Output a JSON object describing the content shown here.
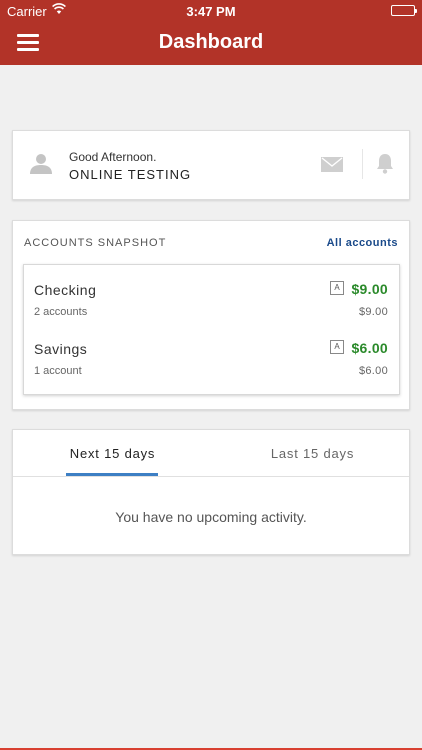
{
  "status": {
    "carrier": "Carrier",
    "time": "3:47 PM"
  },
  "nav": {
    "title": "Dashboard"
  },
  "greeting": {
    "hello": "Good Afternoon.",
    "name": "ONLINE TESTING"
  },
  "snapshot": {
    "heading": "ACCOUNTS SNAPSHOT",
    "all_label": "All accounts",
    "accounts": [
      {
        "name": "Checking",
        "count": "2 accounts",
        "badge": "A",
        "balance": "$9.00",
        "sub_balance": "$9.00"
      },
      {
        "name": "Savings",
        "count": "1 account",
        "badge": "A",
        "balance": "$6.00",
        "sub_balance": "$6.00"
      }
    ]
  },
  "activity": {
    "tabs": [
      {
        "label": "Next 15 days"
      },
      {
        "label": "Last 15 days"
      }
    ],
    "empty_message": "You have no upcoming activity."
  },
  "colors": {
    "brand": "#b23328",
    "positive": "#2b8a2b",
    "link": "#1a4a8a",
    "tab_underline": "#3d7fc4"
  }
}
